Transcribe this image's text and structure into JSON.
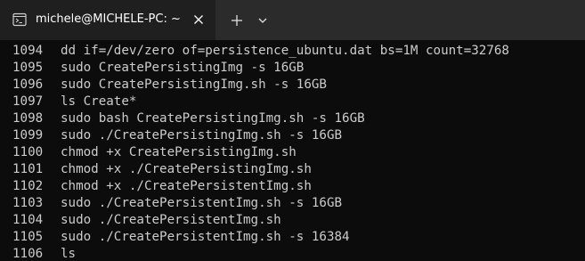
{
  "tab": {
    "title": "michele@MICHELE-PC: ~",
    "icon": "terminal-icon"
  },
  "tabbar": {
    "close_icon": "close-icon",
    "new_tab_icon": "plus-icon",
    "dropdown_icon": "chevron-down-icon"
  },
  "colors": {
    "background": "#0c0c0c",
    "tabbar": "#2b2b2b",
    "active_tab": "#1f1f1f",
    "text": "#cccccc"
  },
  "history": [
    {
      "num": "1094",
      "cmd": "dd if=/dev/zero of=persistence_ubuntu.dat bs=1M count=32768"
    },
    {
      "num": "1095",
      "cmd": "sudo CreatePersistingImg -s 16GB"
    },
    {
      "num": "1096",
      "cmd": "sudo CreatePersistingImg.sh -s 16GB"
    },
    {
      "num": "1097",
      "cmd": "ls Create*"
    },
    {
      "num": "1098",
      "cmd": "sudo bash CreatePersistingImg.sh -s 16GB"
    },
    {
      "num": "1099",
      "cmd": "sudo ./CreatePersistingImg.sh -s 16GB"
    },
    {
      "num": "1100",
      "cmd": "chmod +x CreatePersistingImg.sh"
    },
    {
      "num": "1101",
      "cmd": "chmod +x ./CreatePersistingImg.sh"
    },
    {
      "num": "1102",
      "cmd": "chmod +x ./CreatePersistentImg.sh"
    },
    {
      "num": "1103",
      "cmd": "sudo ./CreatePersistentImg.sh -s 16GB"
    },
    {
      "num": "1104",
      "cmd": "sudo ./CreatePersistentImg.sh"
    },
    {
      "num": "1105",
      "cmd": "sudo ./CreatePersistentImg.sh -s 16384"
    },
    {
      "num": "1106",
      "cmd": "ls"
    }
  ]
}
